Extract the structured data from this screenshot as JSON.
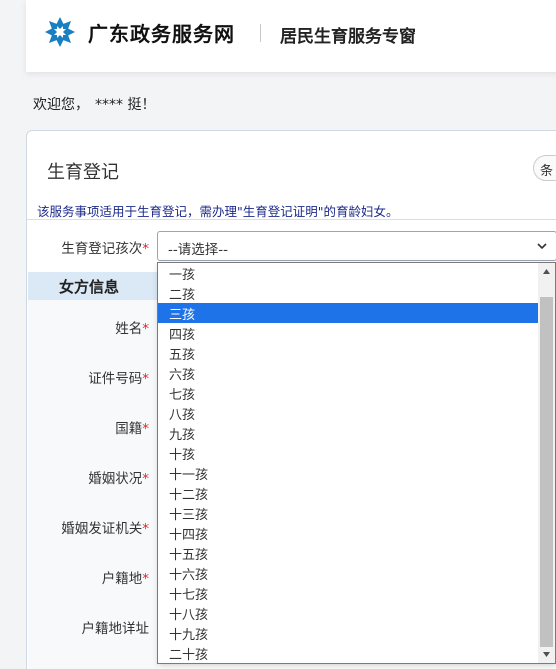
{
  "header": {
    "site_name": "广东政务服务网",
    "subtitle": "居民生育服务专窗",
    "brand_color": "#1a7fc1"
  },
  "welcome": {
    "text": "欢迎您，",
    "user": "**** 挺！"
  },
  "card": {
    "title": "生育登记",
    "tag_label": "条",
    "notice": "该服务事项适用于生育登记，需办理\"生育登记证明\"的育龄妇女。"
  },
  "birth_order": {
    "label": "生育登记孩次",
    "required_mark": "*",
    "value": "--请选择--"
  },
  "section": {
    "title": "女方信息"
  },
  "fields": [
    {
      "label": "姓名",
      "required": "*"
    },
    {
      "label": "证件号码",
      "required": "*"
    },
    {
      "label": "国籍",
      "required": "*"
    },
    {
      "label": "婚姻状况",
      "required": "*"
    },
    {
      "label": "婚姻发证机关",
      "required": "*"
    },
    {
      "label": "户籍地",
      "required": "*"
    },
    {
      "label": "户籍地详址",
      "required": ""
    }
  ],
  "dropdown": {
    "options": [
      "一孩",
      "二孩",
      "三孩",
      "四孩",
      "五孩",
      "六孩",
      "七孩",
      "八孩",
      "九孩",
      "十孩",
      "十一孩",
      "十二孩",
      "十三孩",
      "十四孩",
      "十五孩",
      "十六孩",
      "十七孩",
      "十八孩",
      "十九孩",
      "二十孩"
    ],
    "selected_index": 2,
    "selected_color": "#1e73e8"
  }
}
